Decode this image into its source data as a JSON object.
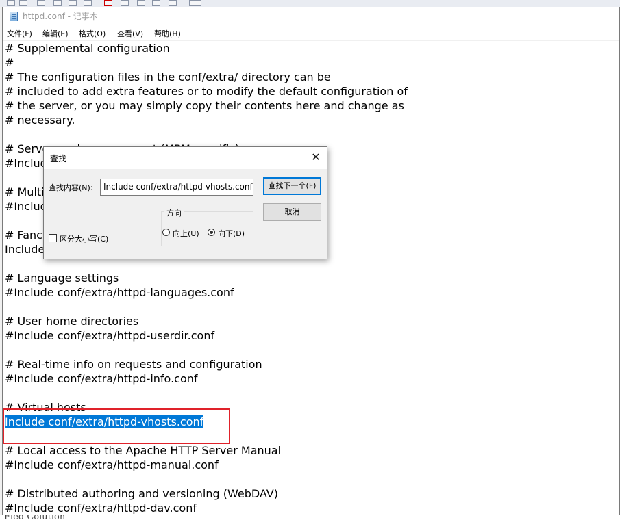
{
  "window": {
    "title": "httpd.conf - 记事本"
  },
  "menu": {
    "items": [
      "文件(F)",
      "编辑(E)",
      "格式(O)",
      "查看(V)",
      "帮助(H)"
    ]
  },
  "editor": {
    "lines": [
      "# Supplemental configuration",
      "#",
      "# The configuration files in the conf/extra/ directory can be",
      "# included to add extra features or to modify the default configuration of",
      "# the server, or you may simply copy their contents here and change as",
      "# necessary.",
      "",
      "# Server-pool management (MPM specific)",
      "#Include conf/extra/httpd-mpm.conf",
      "",
      "# Multi-language error messages",
      "#Include conf/extra/httpd-multilang-errordoc.conf",
      "",
      "# Fancy directory listings",
      "Include conf/extra/httpd-autoindex.conf",
      "",
      "# Language settings",
      "#Include conf/extra/httpd-languages.conf",
      "",
      "# User home directories",
      "#Include conf/extra/httpd-userdir.conf",
      "",
      "# Real-time info on requests and configuration",
      "#Include conf/extra/httpd-info.conf",
      "",
      "# Virtual hosts",
      "Include conf/extra/httpd-vhosts.conf",
      "",
      "# Local access to the Apache HTTP Server Manual",
      "#Include conf/extra/httpd-manual.conf",
      "",
      "# Distributed authoring and versioning (WebDAV)",
      "#Include conf/extra/httpd-dav.conf"
    ],
    "selected_line_index": 26
  },
  "find_dialog": {
    "title": "查找",
    "close_glyph": "✕",
    "find_label": "查找内容(N):",
    "find_value": "Include conf/extra/httpd-vhosts.conf",
    "find_next_label": "查找下一个(F)",
    "cancel_label": "取消",
    "direction_label": "方向",
    "up_label": "向上(U)",
    "down_label": "向下(D)",
    "direction_selected": "down",
    "match_case_label": "区分大小写(C)",
    "match_case_checked": false
  },
  "annotation": {
    "highlight_color": "#e0222a"
  },
  "background_peek": {
    "text": "Fled Colution"
  }
}
